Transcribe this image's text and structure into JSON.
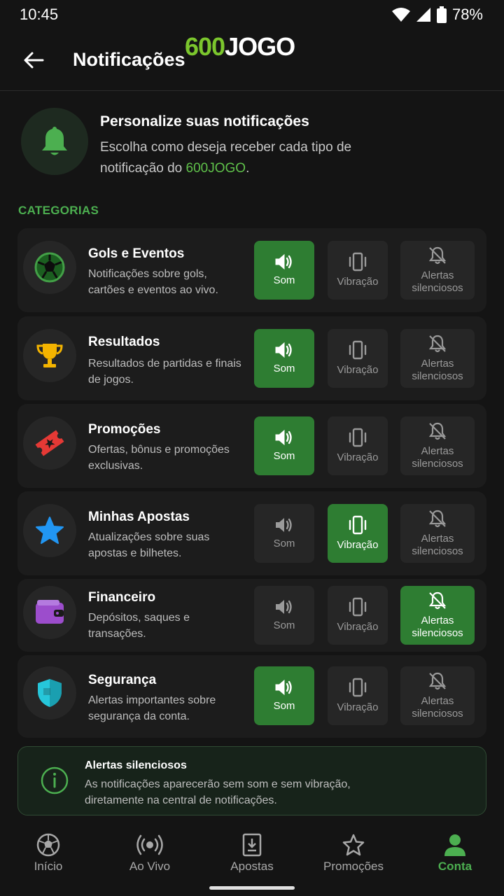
{
  "status": {
    "time": "10:45",
    "battery": "78%"
  },
  "header": {
    "title": "Notificações",
    "logo_num": "600",
    "logo_txt": "JOGO"
  },
  "intro": {
    "title": "Personalize suas notificações",
    "desc_prefix": "Escolha como deseja receber cada tipo de notificação do ",
    "desc_brand": "600JOGO",
    "desc_suffix": "."
  },
  "section_label": "CATEGORIAS",
  "options": {
    "sound": "Som",
    "vibration": "Vibração",
    "silent": "Alertas silenciosos"
  },
  "categories": [
    {
      "title": "Gols e Eventos",
      "desc": "Notificações sobre gols, cartões e eventos ao vivo.",
      "icon": "soccer-ball-icon",
      "selected": "sound"
    },
    {
      "title": "Resultados",
      "desc": "Resultados de partidas e finais de jogos.",
      "icon": "trophy-icon",
      "selected": "sound"
    },
    {
      "title": "Promoções",
      "desc": "Ofertas, bônus e promoções exclusivas.",
      "icon": "ticket-icon",
      "selected": "sound"
    },
    {
      "title": "Minhas Apostas",
      "desc": "Atualizações sobre suas apostas e bilhetes.",
      "icon": "star-icon",
      "selected": "vibration"
    },
    {
      "title": "Financeiro",
      "desc": "Depósitos, saques e transações.",
      "icon": "wallet-icon",
      "selected": "silent"
    },
    {
      "title": "Segurança",
      "desc": "Alertas importantes sobre segurança da conta.",
      "icon": "shield-icon",
      "selected": "sound"
    }
  ],
  "info": {
    "title": "Alertas silenciosos",
    "desc": "As notificações aparecerão sem som e sem vibração, diretamente na central de notificações."
  },
  "nav": [
    {
      "label": "Início",
      "icon": "soccer-ball-icon"
    },
    {
      "label": "Ao Vivo",
      "icon": "broadcast-icon"
    },
    {
      "label": "Apostas",
      "icon": "bet-slip-icon"
    },
    {
      "label": "Promoções",
      "icon": "star-outline-icon"
    },
    {
      "label": "Conta",
      "icon": "user-icon",
      "active": true
    }
  ],
  "colors": {
    "accent": "#4caf50",
    "active_option": "#2e7d32",
    "brand_green": "#7bc62d"
  }
}
